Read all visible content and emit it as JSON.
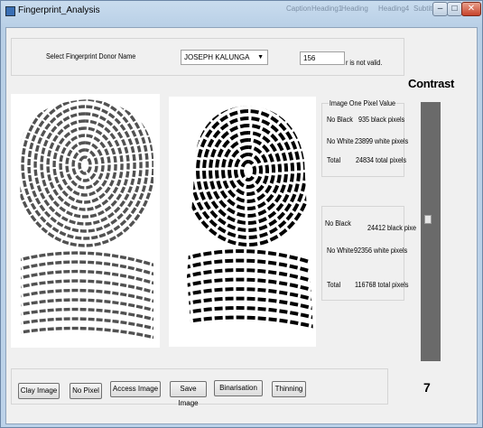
{
  "window": {
    "title": "Fingerprint_Analysis",
    "ghost_text": [
      "Caption",
      "Heading1",
      "Heading",
      "Heading4",
      "Subtitle"
    ]
  },
  "controls": {
    "minimize_glyph": "–",
    "maximize_glyph": "□",
    "close_glyph": "✕"
  },
  "selection": {
    "label": "Select Fingerprint Donor Name",
    "donor": "JOSEPH KALUNGA",
    "pixel_value": "156",
    "validation_text": "r is not valid."
  },
  "stats1": {
    "header": "Image One Pixel Value",
    "black_label": "No Black",
    "black_value": "935 black pixels",
    "white_label": "No White",
    "white_value": "23899 white pixels",
    "total_label": "Total",
    "total_value": "24834 total pixels"
  },
  "stats2": {
    "black_label": "No Black",
    "black_value": "24412 black pixe",
    "white_label": "No White",
    "white_value": "92356 white pixels",
    "total_label": "Total",
    "total_value": "116768 total pixels"
  },
  "contrast": {
    "title": "Contrast",
    "value": "7",
    "level": 0.45
  },
  "toolbar": {
    "clay": "Clay Image",
    "no_pixel": "No Pixel",
    "access": "Access Image",
    "save": "Save Image",
    "binarisation": "Binarisation",
    "thinning": "Thinning"
  }
}
